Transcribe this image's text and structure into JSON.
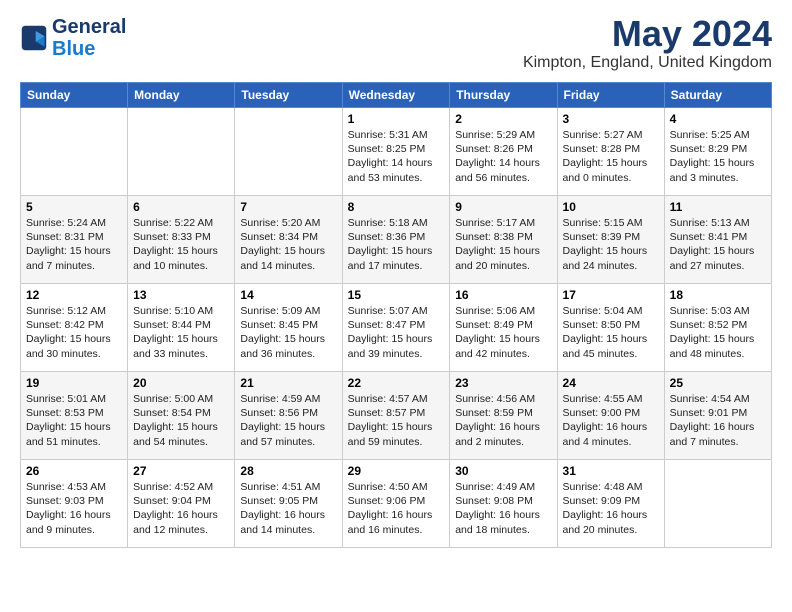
{
  "header": {
    "logo_line1": "General",
    "logo_line2": "Blue",
    "month_year": "May 2024",
    "location": "Kimpton, England, United Kingdom"
  },
  "days_of_week": [
    "Sunday",
    "Monday",
    "Tuesday",
    "Wednesday",
    "Thursday",
    "Friday",
    "Saturday"
  ],
  "weeks": [
    [
      {
        "day": "",
        "info": ""
      },
      {
        "day": "",
        "info": ""
      },
      {
        "day": "",
        "info": ""
      },
      {
        "day": "1",
        "info": "Sunrise: 5:31 AM\nSunset: 8:25 PM\nDaylight: 14 hours and 53 minutes."
      },
      {
        "day": "2",
        "info": "Sunrise: 5:29 AM\nSunset: 8:26 PM\nDaylight: 14 hours and 56 minutes."
      },
      {
        "day": "3",
        "info": "Sunrise: 5:27 AM\nSunset: 8:28 PM\nDaylight: 15 hours and 0 minutes."
      },
      {
        "day": "4",
        "info": "Sunrise: 5:25 AM\nSunset: 8:29 PM\nDaylight: 15 hours and 3 minutes."
      }
    ],
    [
      {
        "day": "5",
        "info": "Sunrise: 5:24 AM\nSunset: 8:31 PM\nDaylight: 15 hours and 7 minutes."
      },
      {
        "day": "6",
        "info": "Sunrise: 5:22 AM\nSunset: 8:33 PM\nDaylight: 15 hours and 10 minutes."
      },
      {
        "day": "7",
        "info": "Sunrise: 5:20 AM\nSunset: 8:34 PM\nDaylight: 15 hours and 14 minutes."
      },
      {
        "day": "8",
        "info": "Sunrise: 5:18 AM\nSunset: 8:36 PM\nDaylight: 15 hours and 17 minutes."
      },
      {
        "day": "9",
        "info": "Sunrise: 5:17 AM\nSunset: 8:38 PM\nDaylight: 15 hours and 20 minutes."
      },
      {
        "day": "10",
        "info": "Sunrise: 5:15 AM\nSunset: 8:39 PM\nDaylight: 15 hours and 24 minutes."
      },
      {
        "day": "11",
        "info": "Sunrise: 5:13 AM\nSunset: 8:41 PM\nDaylight: 15 hours and 27 minutes."
      }
    ],
    [
      {
        "day": "12",
        "info": "Sunrise: 5:12 AM\nSunset: 8:42 PM\nDaylight: 15 hours and 30 minutes."
      },
      {
        "day": "13",
        "info": "Sunrise: 5:10 AM\nSunset: 8:44 PM\nDaylight: 15 hours and 33 minutes."
      },
      {
        "day": "14",
        "info": "Sunrise: 5:09 AM\nSunset: 8:45 PM\nDaylight: 15 hours and 36 minutes."
      },
      {
        "day": "15",
        "info": "Sunrise: 5:07 AM\nSunset: 8:47 PM\nDaylight: 15 hours and 39 minutes."
      },
      {
        "day": "16",
        "info": "Sunrise: 5:06 AM\nSunset: 8:49 PM\nDaylight: 15 hours and 42 minutes."
      },
      {
        "day": "17",
        "info": "Sunrise: 5:04 AM\nSunset: 8:50 PM\nDaylight: 15 hours and 45 minutes."
      },
      {
        "day": "18",
        "info": "Sunrise: 5:03 AM\nSunset: 8:52 PM\nDaylight: 15 hours and 48 minutes."
      }
    ],
    [
      {
        "day": "19",
        "info": "Sunrise: 5:01 AM\nSunset: 8:53 PM\nDaylight: 15 hours and 51 minutes."
      },
      {
        "day": "20",
        "info": "Sunrise: 5:00 AM\nSunset: 8:54 PM\nDaylight: 15 hours and 54 minutes."
      },
      {
        "day": "21",
        "info": "Sunrise: 4:59 AM\nSunset: 8:56 PM\nDaylight: 15 hours and 57 minutes."
      },
      {
        "day": "22",
        "info": "Sunrise: 4:57 AM\nSunset: 8:57 PM\nDaylight: 15 hours and 59 minutes."
      },
      {
        "day": "23",
        "info": "Sunrise: 4:56 AM\nSunset: 8:59 PM\nDaylight: 16 hours and 2 minutes."
      },
      {
        "day": "24",
        "info": "Sunrise: 4:55 AM\nSunset: 9:00 PM\nDaylight: 16 hours and 4 minutes."
      },
      {
        "day": "25",
        "info": "Sunrise: 4:54 AM\nSunset: 9:01 PM\nDaylight: 16 hours and 7 minutes."
      }
    ],
    [
      {
        "day": "26",
        "info": "Sunrise: 4:53 AM\nSunset: 9:03 PM\nDaylight: 16 hours and 9 minutes."
      },
      {
        "day": "27",
        "info": "Sunrise: 4:52 AM\nSunset: 9:04 PM\nDaylight: 16 hours and 12 minutes."
      },
      {
        "day": "28",
        "info": "Sunrise: 4:51 AM\nSunset: 9:05 PM\nDaylight: 16 hours and 14 minutes."
      },
      {
        "day": "29",
        "info": "Sunrise: 4:50 AM\nSunset: 9:06 PM\nDaylight: 16 hours and 16 minutes."
      },
      {
        "day": "30",
        "info": "Sunrise: 4:49 AM\nSunset: 9:08 PM\nDaylight: 16 hours and 18 minutes."
      },
      {
        "day": "31",
        "info": "Sunrise: 4:48 AM\nSunset: 9:09 PM\nDaylight: 16 hours and 20 minutes."
      },
      {
        "day": "",
        "info": ""
      }
    ]
  ]
}
